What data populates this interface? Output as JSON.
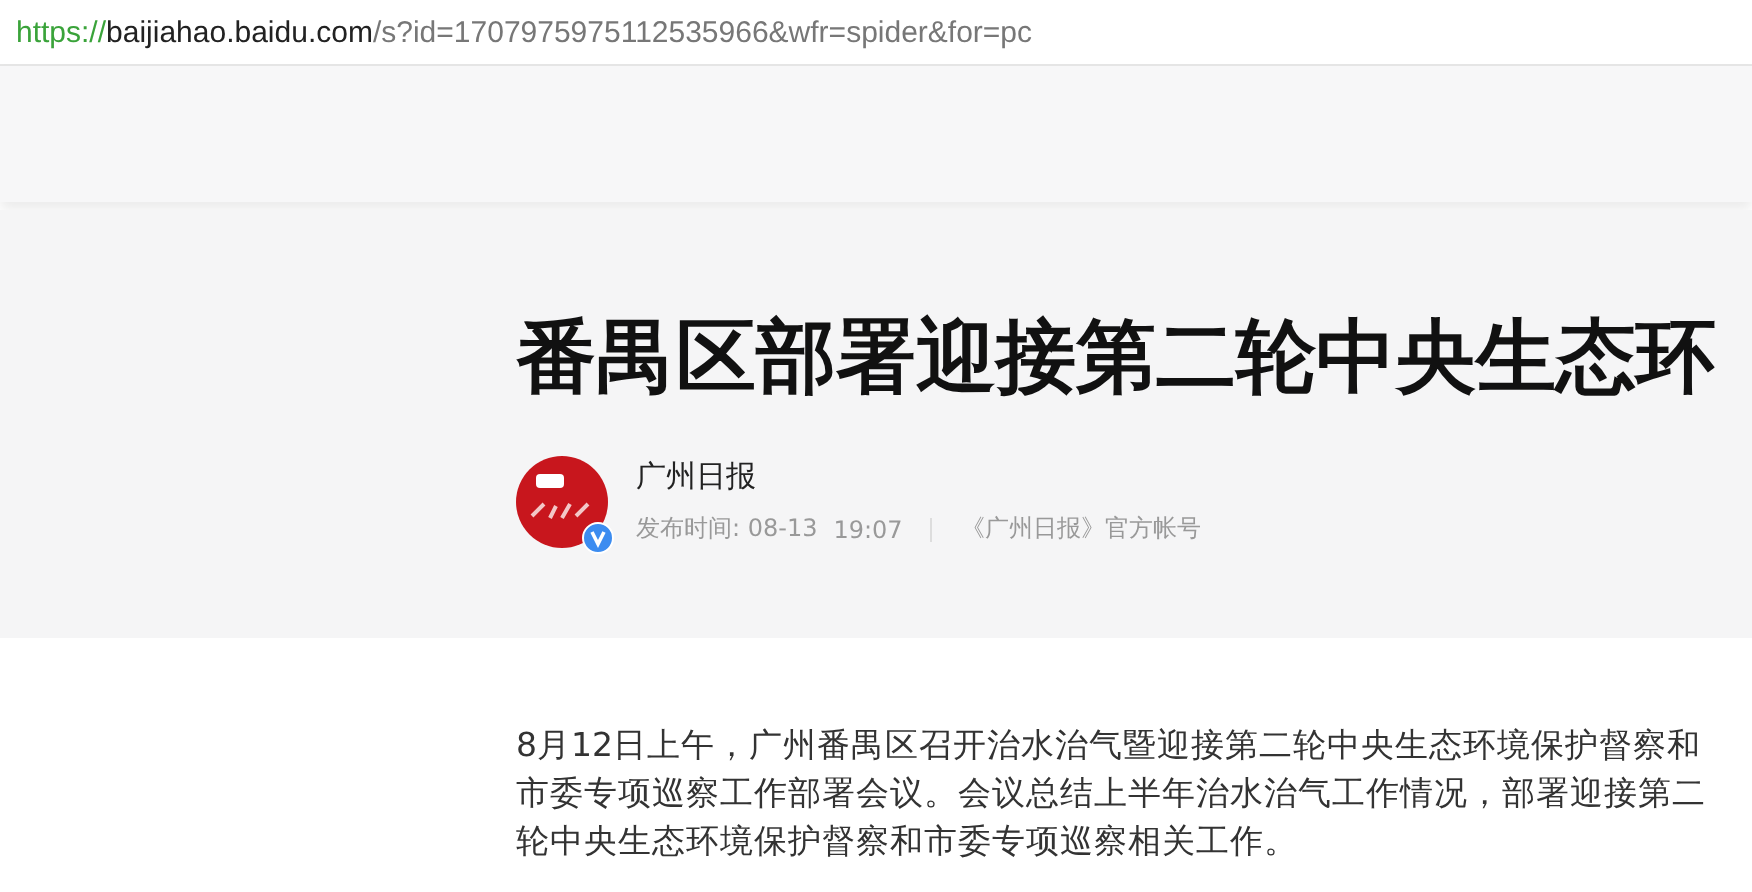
{
  "address_bar": {
    "scheme": "https://",
    "host": "baijiahao.baidu.com",
    "path": "/s?id=1707975975112535966&wfr=spider&for=pc"
  },
  "article": {
    "title": "番禺区部署迎接第二轮中央生态环",
    "author": {
      "name": "广州日报",
      "verified": true,
      "published_label": "发布时间: 08-13",
      "time": "19:07",
      "account": "《广州日报》官方帐号"
    },
    "body": "8月12日上午，广州番禺区召开治水治气暨迎接第二轮中央生态环境保护督察和市委专项巡察工作部署会议。会议总结上半年治水治气工作情况，部署迎接第二轮中央生态环境保护督察和市委专项巡察相关工作。"
  }
}
